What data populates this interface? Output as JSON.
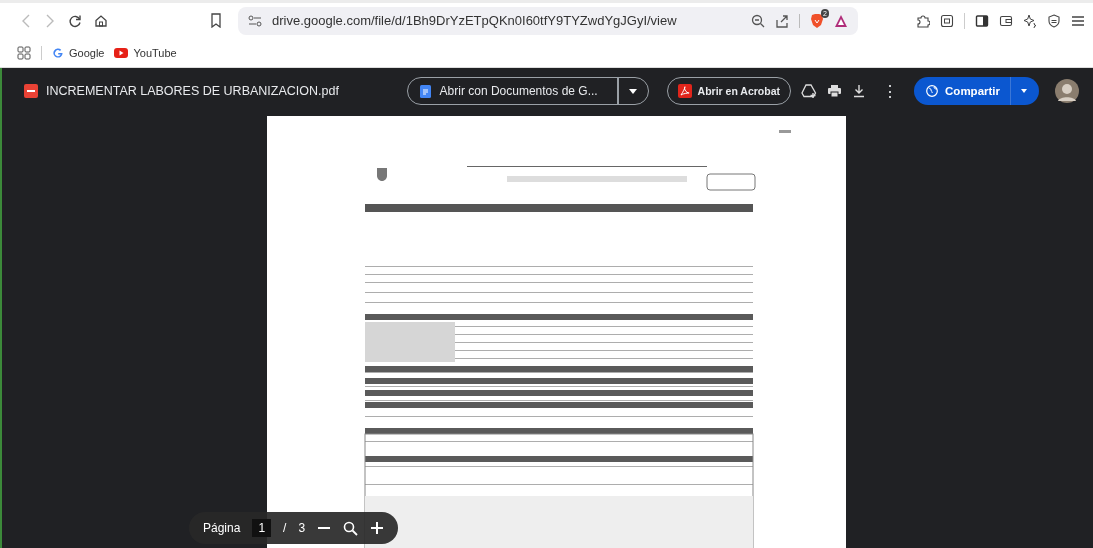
{
  "browser": {
    "url": "drive.google.com/file/d/1Bh9DrYzETpQKn0I60tfY9TYZwdYgJGyI/view",
    "shield_badge": "2",
    "bookmarks": [
      {
        "label": "Google",
        "kind": "google"
      },
      {
        "label": "YouTube",
        "kind": "youtube"
      }
    ]
  },
  "viewer": {
    "file_name": "INCREMENTAR LABORES DE URBANIZACION.pdf",
    "open_with": "Abrir con Documentos de G...",
    "acrobat": "Abrir en Acrobat",
    "more": "⋮",
    "share": "Compartir"
  },
  "pager": {
    "label": "Página",
    "page": "1",
    "separator": "/",
    "total": "3"
  }
}
